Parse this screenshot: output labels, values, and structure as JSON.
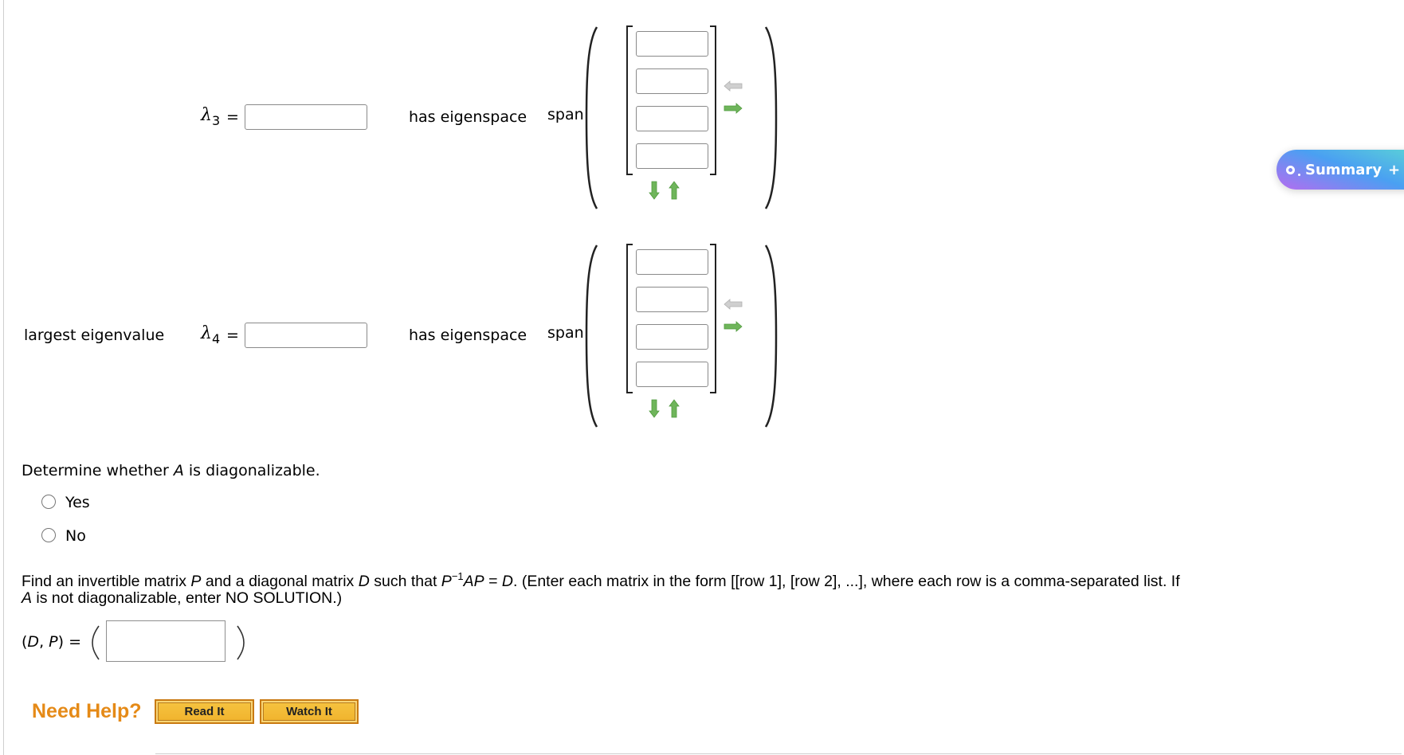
{
  "eigen_rows": [
    {
      "prefix_label": "",
      "lambda_symbol": "λ",
      "lambda_index": "3",
      "equals": "=",
      "value": "",
      "has_eigenspace_label": "has eigenspace",
      "span_label": "span",
      "vector_entries": [
        "",
        "",
        "",
        ""
      ]
    },
    {
      "prefix_label": "largest eigenvalue",
      "lambda_symbol": "λ",
      "lambda_index": "4",
      "equals": "=",
      "value": "",
      "has_eigenspace_label": "has eigenspace",
      "span_label": "span",
      "vector_entries": [
        "",
        "",
        "",
        ""
      ]
    }
  ],
  "icons": {
    "remove_column": "arrow-left-gray",
    "add_column": "arrow-right-green",
    "add_row": "arrow-down-green",
    "remove_row": "arrow-up-green"
  },
  "diagonalizable": {
    "question_prefix": "Determine whether ",
    "question_var": "A",
    "question_suffix": " is diagonalizable.",
    "options": [
      "Yes",
      "No"
    ],
    "selected": null
  },
  "dp_question": {
    "line1_a": "Find an invertible matrix ",
    "var_p": "P",
    "line1_b": " and a diagonal matrix ",
    "var_d": "D",
    "line1_c": " such that ",
    "eq_p": "P",
    "eq_sup": "−1",
    "eq_ap": "AP",
    "eq_eq": " = ",
    "eq_d": "D",
    "line1_d": ". (Enter each matrix in the form [[row 1], [row 2], ...], where each row is a comma-separated list. If",
    "line2_var": "A",
    "line2": " is not diagonalizable, enter NO SOLUTION.)",
    "answer_label_open": "(",
    "answer_label_d": "D",
    "answer_label_sep": ", ",
    "answer_label_p": "P",
    "answer_label_close": ") =",
    "answer_value": ""
  },
  "help": {
    "label": "Need Help?",
    "read_it": "Read It",
    "watch_it": "Watch It"
  },
  "summary_button": {
    "label": "Summary",
    "plus": "+"
  },
  "colors": {
    "need_help": "#e58a17",
    "button_fill": "#f2b830",
    "arrow_green": "#4f9a3c",
    "arrow_gray": "#c8c8c8"
  }
}
